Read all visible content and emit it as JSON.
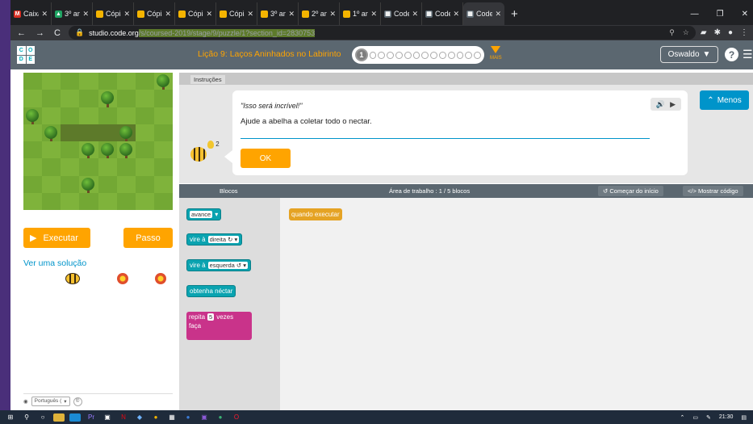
{
  "browser": {
    "tabs": [
      {
        "title": "Caixa",
        "color": "#d93025",
        "glyph": "M"
      },
      {
        "title": "3º an",
        "color": "#1fa463",
        "glyph": "▲"
      },
      {
        "title": "Cópia",
        "color": "#f4b400",
        "glyph": ""
      },
      {
        "title": "Cópia",
        "color": "#f4b400",
        "glyph": ""
      },
      {
        "title": "Cópia",
        "color": "#f4b400",
        "glyph": ""
      },
      {
        "title": "Cópia",
        "color": "#f4b400",
        "glyph": ""
      },
      {
        "title": "3º an",
        "color": "#f4b400",
        "glyph": ""
      },
      {
        "title": "2º an",
        "color": "#f4b400",
        "glyph": ""
      },
      {
        "title": "1º an",
        "color": "#f4b400",
        "glyph": ""
      },
      {
        "title": "Code",
        "color": "#5b6770",
        "glyph": "▦"
      },
      {
        "title": "Code",
        "color": "#5b6770",
        "glyph": "▦"
      },
      {
        "title": "Code",
        "color": "#5b6770",
        "glyph": "▦",
        "active": true
      }
    ],
    "url_host": "studio.code.org",
    "url_path": "/s/coursed-2019/stage/9/puzzle/1?section_id=2830753"
  },
  "header": {
    "logo_letters": [
      "C",
      "O",
      "D",
      "E"
    ],
    "lesson_title": "Lição 9: Laços Aninhados no Labirinto",
    "current_puzzle": "1",
    "more_label": "MAIS",
    "user_name": "Oswaldo",
    "help_label": "?"
  },
  "left": {
    "run_label": "Executar",
    "step_label": "Passo",
    "solution_link": "Ver uma solução",
    "language": "Português (",
    "cc_label": "©"
  },
  "instructions": {
    "tab_label": "Instruções",
    "quote": "\"Isso será incrível!\"",
    "text": "Ajude a abelha a coletar todo o nectar.",
    "ok_label": "OK",
    "hint_count": "2",
    "less_label": "Menos"
  },
  "workspace": {
    "blocks_header": "Blocos",
    "workspace_header": "Área de trabalho : 1 / 5 blocos",
    "restart_label": "Começar do início",
    "show_code_label": "Mostrar código",
    "toolbox_blocks": {
      "move": "avance",
      "turn_right_prefix": "vire à",
      "turn_right_dir": "direita ↻",
      "turn_left_prefix": "vire à",
      "turn_left_dir": "esquerda ↺",
      "get_nectar": "obtenha néctar",
      "repeat_prefix": "repita",
      "repeat_count": "5",
      "repeat_suffix": "vezes",
      "repeat_do": "faça"
    },
    "when_run": "quando executar"
  },
  "taskbar": {
    "time": "21:30"
  }
}
